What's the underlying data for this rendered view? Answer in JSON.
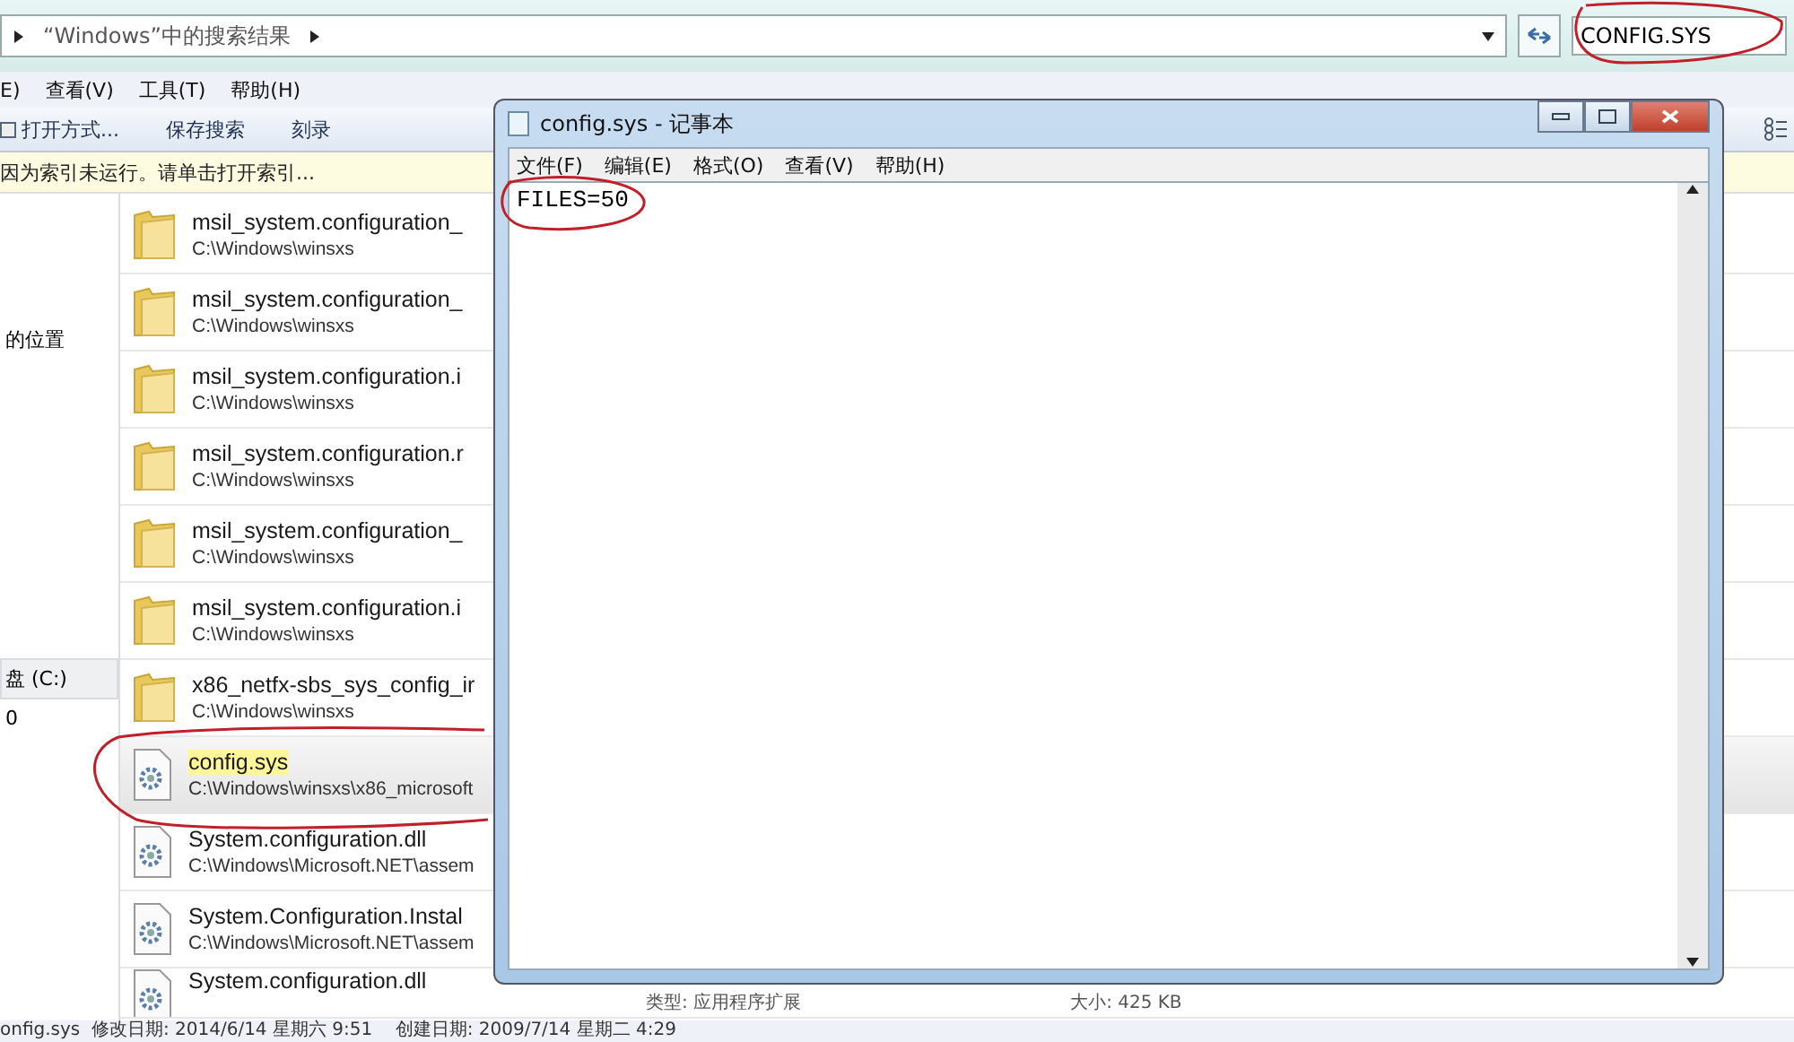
{
  "explorer": {
    "breadcrumb": [
      {
        "label": "“Windows”中的搜索结果"
      }
    ],
    "search": {
      "value": "CONFIG.SYS"
    },
    "menu": [
      "E)",
      "查看(V)",
      "工具(T)",
      "帮助(H)"
    ],
    "toolbar": [
      "打开方式...",
      "保存搜索",
      "刻录"
    ],
    "info_bar": "因为索引未运行。请单击打开索引...",
    "sidebar": [
      {
        "label": "的位置",
        "selected": false
      },
      {
        "label": "盘 (C:)",
        "selected": true
      },
      {
        "label": "0",
        "selected": false
      }
    ],
    "results": [
      {
        "kind": "folder",
        "name": "msil_system.configuration_",
        "path": "C:\\Windows\\winsxs",
        "selected": false,
        "highlighted": false
      },
      {
        "kind": "folder",
        "name": "msil_system.configuration_",
        "path": "C:\\Windows\\winsxs",
        "selected": false,
        "highlighted": false
      },
      {
        "kind": "folder",
        "name": "msil_system.configuration.i",
        "path": "C:\\Windows\\winsxs",
        "selected": false,
        "highlighted": false
      },
      {
        "kind": "folder",
        "name": "msil_system.configuration.r",
        "path": "C:\\Windows\\winsxs",
        "selected": false,
        "highlighted": false
      },
      {
        "kind": "folder",
        "name": "msil_system.configuration_",
        "path": "C:\\Windows\\winsxs",
        "selected": false,
        "highlighted": false
      },
      {
        "kind": "folder",
        "name": "msil_system.configuration.i",
        "path": "C:\\Windows\\winsxs",
        "selected": false,
        "highlighted": false
      },
      {
        "kind": "folder",
        "name": "x86_netfx-sbs_sys_config_ir",
        "path": "C:\\Windows\\winsxs",
        "selected": false,
        "highlighted": false
      },
      {
        "kind": "file",
        "name": "config.sys",
        "path": "C:\\Windows\\winsxs\\x86_microsoft",
        "selected": true,
        "highlighted": true
      },
      {
        "kind": "file",
        "name": "System.configuration.dll",
        "path": "C:\\Windows\\Microsoft.NET\\assem",
        "selected": false,
        "highlighted": false
      },
      {
        "kind": "file",
        "name": "System.Configuration.Instal",
        "path": "C:\\Windows\\Microsoft.NET\\assem",
        "selected": false,
        "highlighted": false
      },
      {
        "kind": "file",
        "name": "System.configuration.dll",
        "type": "类型: 应用程序扩展",
        "size": "大小: 425 KB",
        "selected": false,
        "highlighted": false
      }
    ],
    "status_bar": "onfig.sys  修改日期: 2014/6/14 星期六 9:51    创建日期: 2009/7/14 星期二 4:29"
  },
  "notepad": {
    "title": "config.sys - 记事本",
    "menu": [
      "文件(F)",
      "编辑(E)",
      "格式(O)",
      "查看(V)",
      "帮助(H)"
    ],
    "content": "FILES=50"
  }
}
